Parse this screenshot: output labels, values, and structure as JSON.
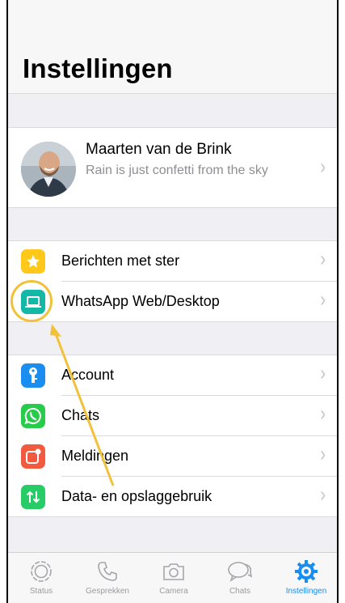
{
  "header": {
    "title": "Instellingen"
  },
  "profile": {
    "name": "Maarten van de Brink",
    "status": "Rain is just confetti from the sky"
  },
  "menu_group_1": [
    {
      "label": "Berichten met ster",
      "icon": "star-icon",
      "color": "#ffc81a"
    },
    {
      "label": "WhatsApp Web/Desktop",
      "icon": "laptop-icon",
      "color": "#14b8a6"
    }
  ],
  "menu_group_2": [
    {
      "label": "Account",
      "icon": "key-icon",
      "color": "#1a8ef0"
    },
    {
      "label": "Chats",
      "icon": "whatsapp-icon",
      "color": "#27cc4a"
    },
    {
      "label": "Meldingen",
      "icon": "notification-icon",
      "color": "#f15a3f"
    },
    {
      "label": "Data- en opslaggebruik",
      "icon": "data-arrows-icon",
      "color": "#27cc66"
    }
  ],
  "tabs": [
    {
      "label": "Status",
      "icon": "status-icon",
      "active": false
    },
    {
      "label": "Gesprekken",
      "icon": "phone-icon",
      "active": false
    },
    {
      "label": "Camera",
      "icon": "camera-icon",
      "active": false
    },
    {
      "label": "Chats",
      "icon": "chat-bubbles-icon",
      "active": false
    },
    {
      "label": "Instellingen",
      "icon": "gear-icon",
      "active": true
    }
  ],
  "colors": {
    "accent": "#1a8ef0",
    "annotation": "#f2c13a",
    "background": "#efeff4"
  }
}
